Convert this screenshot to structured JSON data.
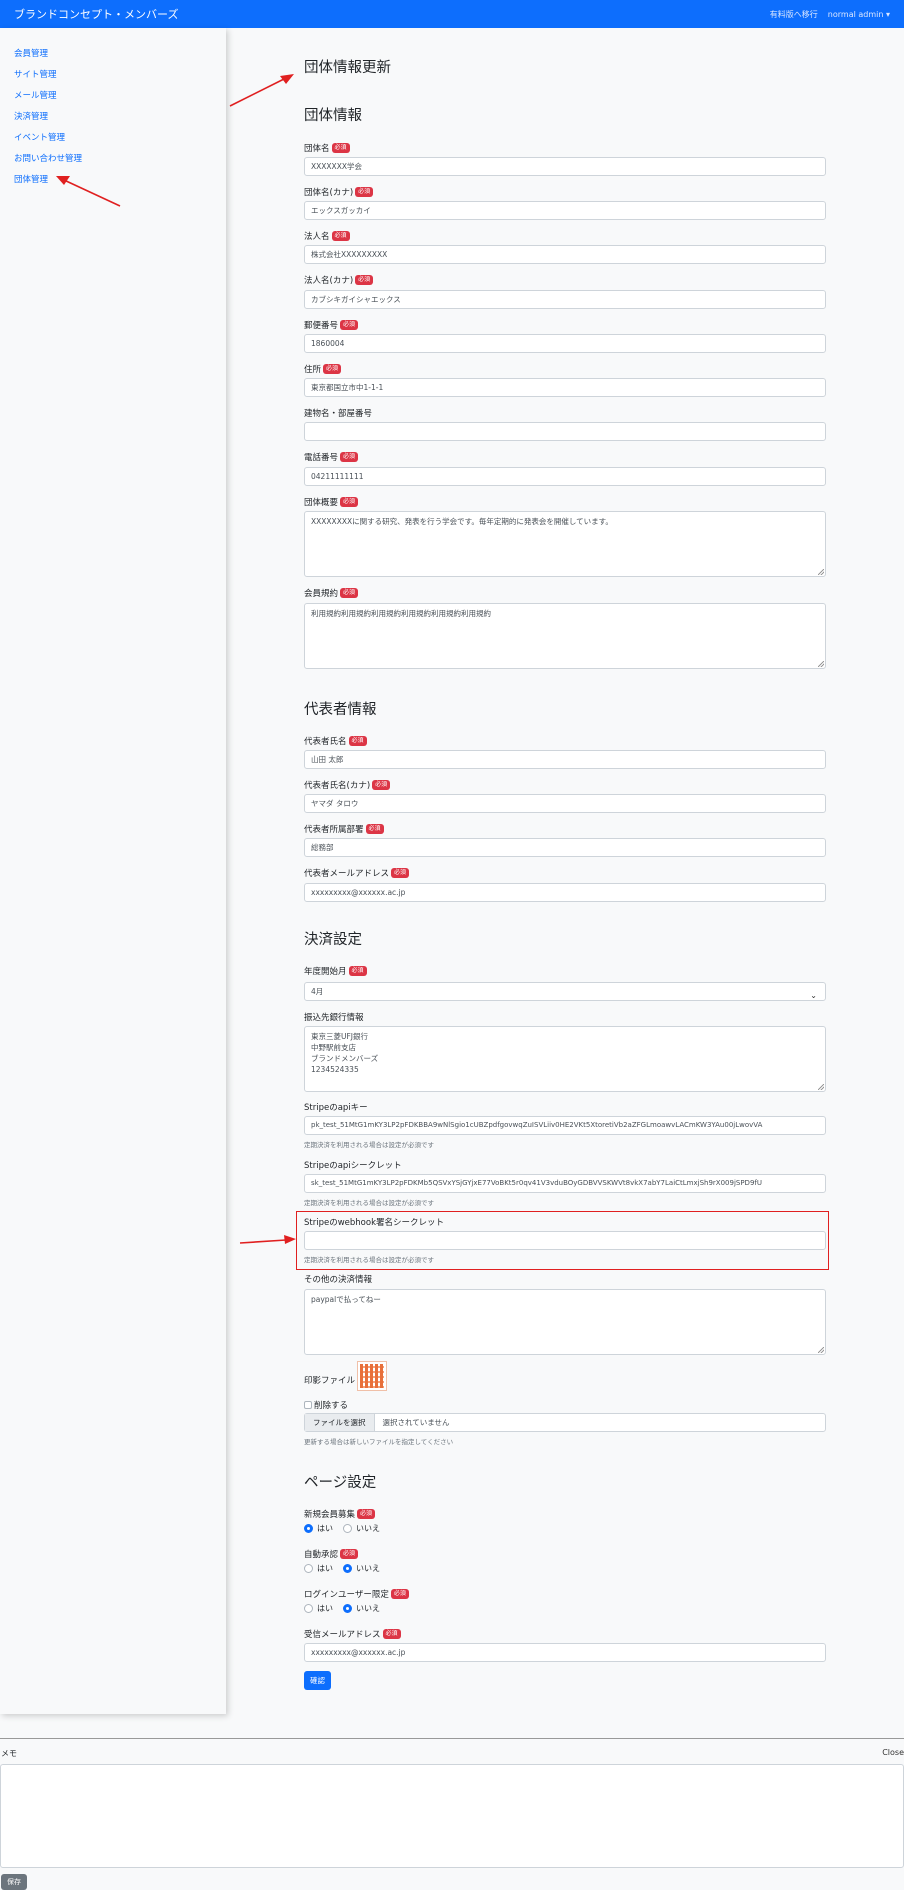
{
  "navbar": {
    "brand": "ブランドコンセプト・メンバーズ",
    "paid_plan": "有料版へ移行",
    "user": "normal admin",
    "user_caret": "▾"
  },
  "sidebar": {
    "items": [
      "会員管理",
      "サイト管理",
      "メール管理",
      "決済管理",
      "イベント管理",
      "お問い合わせ管理",
      "団体管理"
    ]
  },
  "required_badge": "必須",
  "page_title": "団体情報更新",
  "org": {
    "heading": "団体情報",
    "name_label": "団体名",
    "name_value": "XXXXXXX学会",
    "name_kana_label": "団体名(カナ)",
    "name_kana_value": "エックスガッカイ",
    "corp_label": "法人名",
    "corp_value": "株式会社XXXXXXXXX",
    "corp_kana_label": "法人名(カナ)",
    "corp_kana_value": "カブシキガイシャエックス",
    "zip_label": "郵便番号",
    "zip_value": "1860004",
    "addr_label": "住所",
    "addr_value": "東京都国立市中1-1-1",
    "building_label": "建物名・部屋番号",
    "building_value": "",
    "tel_label": "電話番号",
    "tel_value": "04211111111",
    "summary_label": "団体概要",
    "summary_value": "XXXXXXXXに関する研究、発表を行う学会です。毎年定期的に発表会を開催しています。",
    "rules_label": "会員規約",
    "rules_value": "利用規約利用規約利用規約利用規約利用規約利用規約"
  },
  "rep": {
    "heading": "代表者情報",
    "name_label": "代表者氏名",
    "name_value": "山田 太郎",
    "kana_label": "代表者氏名(カナ)",
    "kana_value": "ヤマダ タロウ",
    "dept_label": "代表者所属部署",
    "dept_value": "総務部",
    "email_label": "代表者メールアドレス",
    "email_value": "xxxxxxxxx@xxxxxx.ac.jp"
  },
  "pay": {
    "heading": "決済設定",
    "fiscal_label": "年度開始月",
    "fiscal_value": "4月",
    "fiscal_caret": "⌄",
    "bank_label": "振込先銀行情報",
    "bank_value": "東京三菱UFJ銀行\n中野駅前支店\nブランドメンバーズ\n1234524335",
    "stripe_key_label": "Stripeのapiキー",
    "stripe_key_value": "pk_test_51MtG1mKY3LP2pFDKBBA9wNlSgio1cUBZpdfgovwqZuISVLiiv0HE2VKt5XtoretiVb2aZFGLmoawvLACmKW3YAu00jLwovVA",
    "stripe_key_help": "定期決済を利用される場合は設定が必須です",
    "stripe_secret_label": "Stripeのapiシークレット",
    "stripe_secret_value": "sk_test_51MtG1mKY3LP2pFDKMb5QSVxYSjGYjxE77VoBKt5r0qv41V3vduBOyGDBVVSKWVt8vkX7abY7LaiCtLmxjSh9rX009jSPD9fU",
    "stripe_secret_help": "定期決済を利用される場合は設定が必須です",
    "webhook_label": "Stripeのwebhook署名シークレット",
    "webhook_value": "",
    "webhook_help": "定期決済を利用される場合は設定が必須です",
    "other_label": "その他の決済情報",
    "other_value": "paypalで払ってねー",
    "seal_label": "印影ファイル",
    "delete_label": "削除する",
    "file_button": "ファイルを選択",
    "file_text": "選択されていません",
    "file_help": "更新する場合は新しいファイルを指定してください"
  },
  "page_settings": {
    "heading": "ページ設定",
    "signup_label": "新規会員募集",
    "auto_approve_label": "自動承認",
    "login_only_label": "ログインユーザー限定",
    "yes": "はい",
    "no": "いいえ",
    "receive_email_label": "受信メールアドレス",
    "receive_email_value": "xxxxxxxxx@xxxxxx.ac.jp",
    "confirm_button": "確認"
  },
  "memo": {
    "title": "メモ",
    "close": "Close",
    "save": "保存"
  },
  "colors": {
    "primary": "#0d6efd",
    "danger": "#dc3545",
    "annotation": "#e02020"
  }
}
